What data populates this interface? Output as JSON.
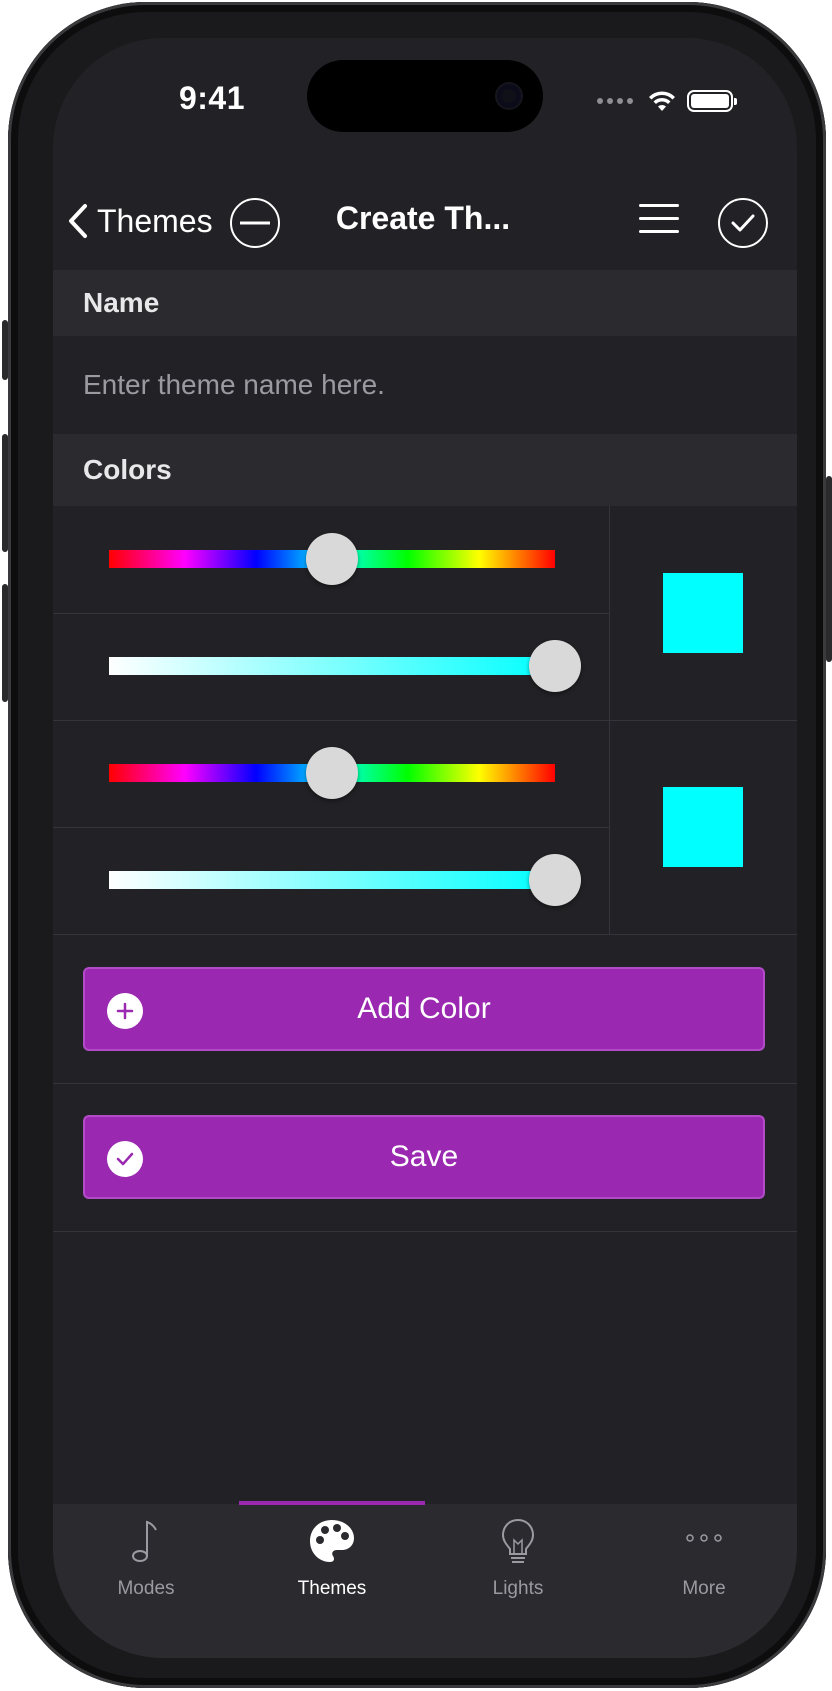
{
  "status_bar": {
    "time": "9:41"
  },
  "nav": {
    "back_label": "Themes",
    "title": "Create Th..."
  },
  "name_section": {
    "header": "Name",
    "placeholder": "Enter theme name here.",
    "value": ""
  },
  "colors_section": {
    "header": "Colors",
    "colors": [
      {
        "hue_fraction": 0.5,
        "saturation_fraction": 1.0,
        "swatch": "#00ffff"
      },
      {
        "hue_fraction": 0.5,
        "saturation_fraction": 1.0,
        "swatch": "#00ffff"
      }
    ]
  },
  "buttons": {
    "add_color": "Add Color",
    "save": "Save"
  },
  "accent_color": "#9a28b0",
  "tabbar": {
    "active": "Themes",
    "items": [
      {
        "label": "Modes",
        "icon": "music-note-icon"
      },
      {
        "label": "Themes",
        "icon": "palette-icon"
      },
      {
        "label": "Lights",
        "icon": "lightbulb-icon"
      },
      {
        "label": "More",
        "icon": "more-dots-icon"
      }
    ]
  }
}
